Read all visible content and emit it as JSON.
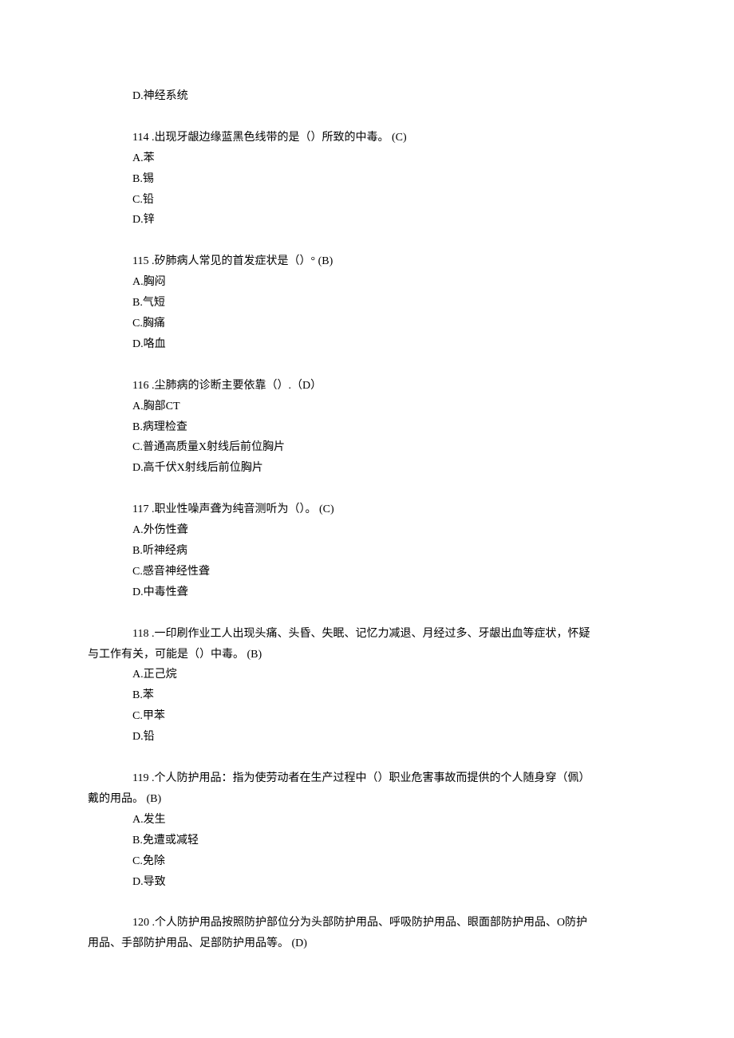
{
  "lines": [
    {
      "cls": "line",
      "text": "D.神经系统"
    },
    {
      "cls": "line qline",
      "text": "114 .出现牙龈边缘蓝黑色线带的是（）所致的中毒。 (C)"
    },
    {
      "cls": "line",
      "text": "A.苯"
    },
    {
      "cls": "line",
      "text": "B.锡"
    },
    {
      "cls": "line",
      "text": "C.铅"
    },
    {
      "cls": "line",
      "text": "D.锌"
    },
    {
      "cls": "line qline",
      "text": "115 .矽肺病人常见的首发症状是（）° (B)"
    },
    {
      "cls": "line",
      "text": "A.胸闷"
    },
    {
      "cls": "line",
      "text": "B.气短"
    },
    {
      "cls": "line",
      "text": "C.胸痛"
    },
    {
      "cls": "line",
      "text": "D.咯血"
    },
    {
      "cls": "line qline",
      "text": "116 .尘肺病的诊断主要依靠（）.（D）"
    },
    {
      "cls": "line",
      "text": "A.胸部CT"
    },
    {
      "cls": "line",
      "text": "B.病理检查"
    },
    {
      "cls": "line",
      "text": "C.普通高质量X射线后前位胸片"
    },
    {
      "cls": "line",
      "text": "D.高千伏X射线后前位胸片"
    },
    {
      "cls": "line qline",
      "text": "117 .职业性噪声聋为纯音测听为（）。 (C)"
    },
    {
      "cls": "line",
      "text": "A.外伤性聋"
    },
    {
      "cls": "line",
      "text": "B.听神经病"
    },
    {
      "cls": "line",
      "text": "C.感音神经性聋"
    },
    {
      "cls": "line",
      "text": "D.中毒性聋"
    },
    {
      "cls": "line qline",
      "text": "118 .一印刷作业工人出现头痛、头昏、失眠、记忆力减退、月经过多、牙龈出血等症状，怀疑",
      "wrap": true
    },
    {
      "cls": "line",
      "text": "与工作有关，可能是（）中毒。 (B)",
      "outdent": true
    },
    {
      "cls": "line",
      "text": "A.正己烷"
    },
    {
      "cls": "line",
      "text": "B.苯"
    },
    {
      "cls": "line",
      "text": "C.甲苯"
    },
    {
      "cls": "line",
      "text": "D.铅"
    },
    {
      "cls": "line qline",
      "text": "119 .个人防护用品：指为使劳动者在生产过程中（）职业危害事故而提供的个人随身穿（佩）",
      "wrap": true
    },
    {
      "cls": "line",
      "text": "戴的用品。 (B)",
      "outdent": true
    },
    {
      "cls": "line",
      "text": "A.发生"
    },
    {
      "cls": "line",
      "text": "B.免遭或减轻"
    },
    {
      "cls": "line",
      "text": "C.免除"
    },
    {
      "cls": "line",
      "text": "D.导致"
    },
    {
      "cls": "line qline",
      "text": "120 .个人防护用品按照防护部位分为头部防护用品、呼吸防护用品、眼面部防护用品、O防护",
      "wrap": true
    },
    {
      "cls": "line",
      "text": "用品、手部防护用品、足部防护用品等。 (D)",
      "outdent": true
    }
  ]
}
